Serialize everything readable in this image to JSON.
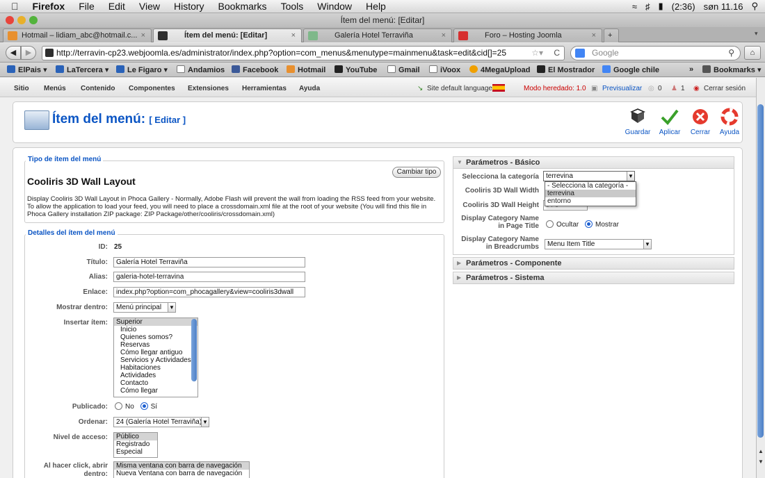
{
  "macmenu": {
    "apple": "",
    "items": [
      "Firefox",
      "File",
      "Edit",
      "View",
      "History",
      "Bookmarks",
      "Tools",
      "Window",
      "Help"
    ],
    "battery": "(2:36)",
    "clock": "søn 11.16"
  },
  "window_title": "Ítem del menú: [Editar]",
  "tabs": [
    {
      "label": "Hotmail – lidiam_abc@hotmail.c...",
      "color": "#e8902f"
    },
    {
      "label": "Ítem del menú: [Editar]",
      "color": "#2e2e2e"
    },
    {
      "label": "Galería Hotel Terraviña",
      "color": "#7fb88a"
    },
    {
      "label": "Foro – Hosting Joomla",
      "color": "#d63030"
    }
  ],
  "url": "http://terravin-cp23.webjoomla.es/administrator/index.php?option=com_menus&menutype=mainmenu&task=edit&cid[]=25",
  "search_placeholder": "Google",
  "bookmarks": [
    {
      "label": "ElPais ▾",
      "color": "#2a62b8"
    },
    {
      "label": "LaTercera ▾",
      "color": "#2a62b8"
    },
    {
      "label": "Le Figaro ▾",
      "color": "#2a62b8"
    },
    {
      "label": "Andamios",
      "color": "#ffffff"
    },
    {
      "label": "Facebook",
      "color": "#3b5998"
    },
    {
      "label": "Hotmail",
      "color": "#e8902f"
    },
    {
      "label": "YouTube",
      "color": "#222222"
    },
    {
      "label": "Gmail",
      "color": "#ffffff"
    },
    {
      "label": "iVoox",
      "color": "#ffffff"
    },
    {
      "label": "4MegaUpload",
      "color": "#f0a000"
    },
    {
      "label": "El Mostrador",
      "color": "#222222"
    },
    {
      "label": "Google chile",
      "color": "#4285f4"
    }
  ],
  "bookmarks_more": "»",
  "bookmarks_menu": "Bookmarks ▾",
  "admin_menu": [
    "Sitio",
    "Menús",
    "Contenido",
    "Componentes",
    "Extensiones",
    "Herramientas",
    "Ayuda"
  ],
  "status": {
    "language": "Site default language:",
    "legacy": "Modo heredado: 1.0",
    "preview": "Previsualizar",
    "messages": "0",
    "users": "1",
    "logout": "Cerrar sesión"
  },
  "page_title": "Ítem del menú:",
  "page_subtitle": "[ Editar ]",
  "toolbar": {
    "save": "Guardar",
    "apply": "Aplicar",
    "close": "Cerrar",
    "help": "Ayuda"
  },
  "type_section": {
    "legend": "Tipo de ítem del menú",
    "change_button": "Cambiar tipo",
    "type_name": "Cooliris 3D Wall Layout",
    "description": "Display Cooliris 3D Wall Layout in Phoca Gallery - Normally, Adobe Flash will prevent the wall from loading the RSS feed from your website. To allow the application to load your feed, you will need to place a crossdomain.xml file at the root of your website (You will find this file in Phoca Gallery installation ZIP package: ZIP Package/other/cooliris/crossdomain.xml)"
  },
  "details": {
    "legend": "Detalles del ítem del menú",
    "id_label": "ID:",
    "id_value": "25",
    "title_label": "Título:",
    "title_value": "Galería Hotel Terraviña",
    "alias_label": "Alias:",
    "alias_value": "galeria-hotel-terravina",
    "link_label": "Enlace:",
    "link_value": "index.php?option=com_phocagallery&view=cooliris3dwall",
    "display_in_label": "Mostrar dentro:",
    "display_in_value": "Menú principal",
    "parent_label": "Insertar ítem:",
    "parent_items": [
      "Superior",
      "Inicio",
      "Quienes somos?",
      "Reservas",
      "Cómo llegar antiguo",
      "Servicios y Actividades",
      "Habitaciones",
      "Actividades",
      "Contacto",
      "Cómo llegar"
    ],
    "published_label": "Publicado:",
    "published_no": "No",
    "published_yes": "Sí",
    "order_label": "Ordenar:",
    "order_value": "24 (Galería Hotel Terraviña)",
    "access_label": "Nivel de acceso:",
    "access_items": [
      "Público",
      "Registrado",
      "Especial"
    ],
    "click_label": "Al hacer click, abrir dentro:",
    "click_items": [
      "Misma ventana con barra de navegación",
      "Nueva Ventana con barra de navegación"
    ]
  },
  "params_basic": {
    "header": "Parámetros - Básico",
    "category_label": "Selecciona la categoría",
    "category_value": "terrevina",
    "dropdown_options": [
      "- Selecciona la categoría -",
      "terrevina",
      "entorno"
    ],
    "width_label": "Cooliris 3D Wall Width",
    "height_label": "Cooliris 3D Wall Height",
    "height_value_partial": "5 7 0",
    "show_cat_title_label": "Display Category Name in Page Title",
    "hide": "Ocultar",
    "show": "Mostrar",
    "show_cat_breadcrumb_label": "Display Category Name in Breadcrumbs",
    "breadcrumb_value": "Menu Item Title"
  },
  "params_component": "Parámetros - Componente",
  "params_system": "Parámetros - Sistema"
}
